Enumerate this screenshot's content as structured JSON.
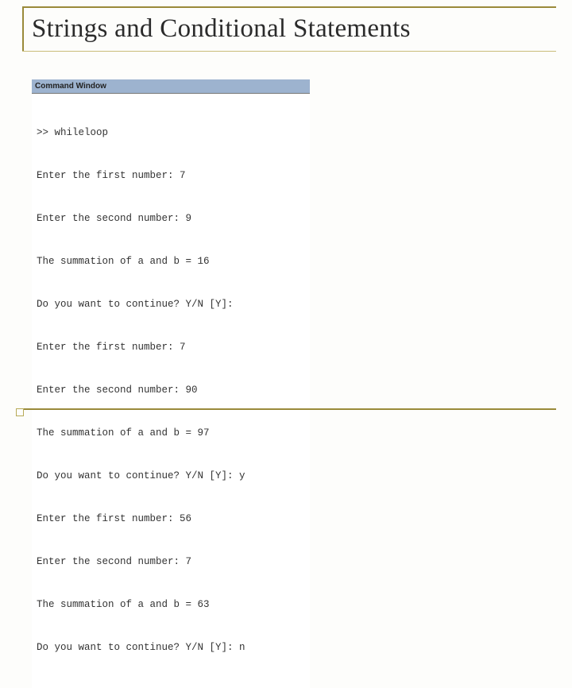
{
  "slide": {
    "title": "Strings and Conditional Statements"
  },
  "commandWindow": {
    "titlebar": "Command Window",
    "lines": [
      ">> whileloop",
      "Enter the first number: 7",
      "Enter the second number: 9",
      "The summation of a and b = 16",
      "Do you want to continue? Y/N [Y]:",
      "Enter the first number: 7",
      "Enter the second number: 90",
      "The summation of a and b = 97",
      "Do you want to continue? Y/N [Y]: y",
      "Enter the first number: 56",
      "Enter the second number: 7",
      "The summation of a and b = 63",
      "Do you want to continue? Y/N [Y]: n"
    ]
  }
}
